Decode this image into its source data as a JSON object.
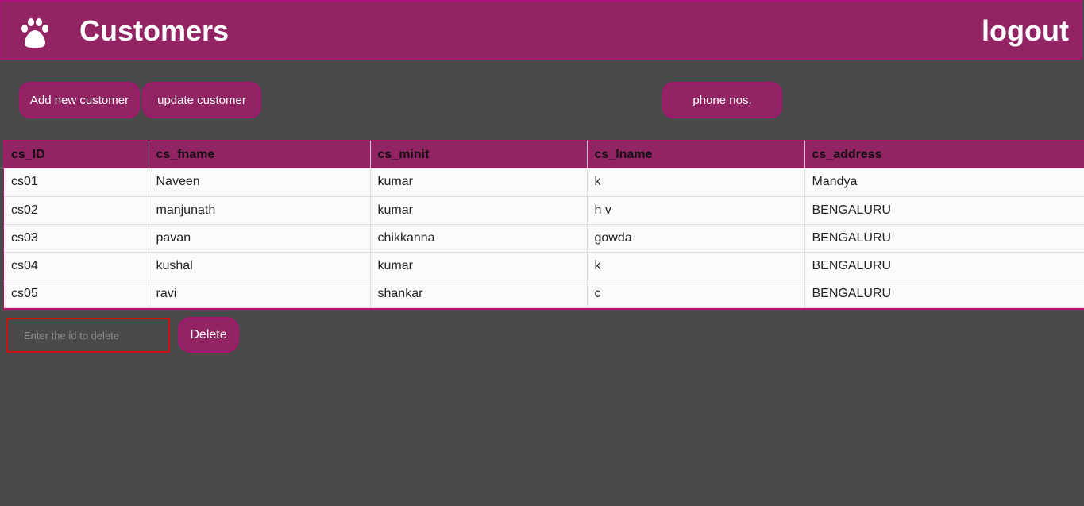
{
  "header": {
    "title": "Customers",
    "logout_label": "logout",
    "logo_icon": "paw-icon",
    "background": "#922463"
  },
  "actions": {
    "add_label": "Add new customer",
    "update_label": "update customer",
    "phone_label": "phone nos."
  },
  "table": {
    "columns": [
      "cs_ID",
      "cs_fname",
      "cs_minit",
      "cs_lname",
      "cs_address"
    ],
    "rows": [
      [
        "cs01",
        "Naveen",
        "kumar",
        "k",
        "Mandya"
      ],
      [
        "cs02",
        "manjunath",
        "kumar",
        "h v",
        "BENGALURU"
      ],
      [
        "cs03",
        "pavan",
        "chikkanna",
        "gowda",
        "BENGALURU"
      ],
      [
        "cs04",
        "kushal",
        "kumar",
        "k",
        "BENGALURU"
      ],
      [
        "cs05",
        "ravi",
        "shankar",
        "c",
        "BENGALURU"
      ]
    ]
  },
  "delete": {
    "placeholder": "Enter the id to delete",
    "value": "",
    "button_label": "Delete"
  },
  "colors": {
    "accent": "#922463",
    "page_background": "#4a4a4a",
    "input_border": "#cc1111"
  }
}
